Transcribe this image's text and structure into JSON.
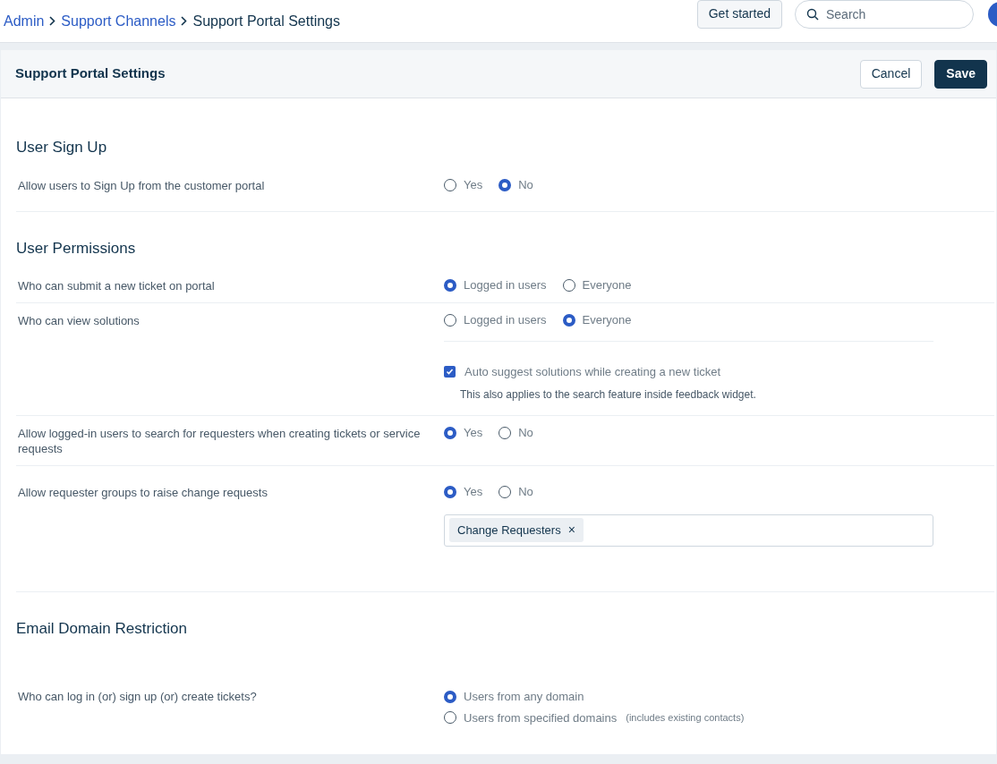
{
  "breadcrumb": [
    {
      "label": "Admin",
      "link": true
    },
    {
      "label": "Support Channels",
      "link": true
    },
    {
      "label": "Support Portal Settings",
      "link": false
    }
  ],
  "top_actions": {
    "get_started": "Get started",
    "search": {
      "placeholder": "Search"
    }
  },
  "header": {
    "title": "Support Portal Settings",
    "buttons": [
      {
        "label": "Cancel",
        "kind": "secondary"
      },
      {
        "label": "Save",
        "kind": "primary"
      }
    ]
  },
  "sections": [
    {
      "title": "User Sign Up",
      "rows": [
        {
          "label": "Allow users to Sign Up from the customer portal",
          "kind": "inline",
          "options": [
            {
              "label": "Yes",
              "selected": false
            },
            {
              "label": "No",
              "selected": true
            }
          ]
        }
      ]
    },
    {
      "title": "User Permissions",
      "rows": [
        {
          "label": "Who can submit a new ticket on portal",
          "kind": "inline",
          "options": [
            {
              "label": "Logged in users",
              "selected": true
            },
            {
              "label": "Everyone",
              "selected": false
            }
          ]
        },
        {
          "label": "Who can view solutions",
          "kind": "inline",
          "options": [
            {
              "label": "Logged in users",
              "selected": false
            },
            {
              "label": "Everyone",
              "selected": true
            }
          ],
          "checkbox": {
            "label": "Auto suggest solutions while creating a new ticket",
            "checked": true,
            "hint": "This also applies to the search feature inside feedback widget."
          }
        },
        {
          "label": "Allow logged-in users to search for requesters when creating tickets or service requests",
          "kind": "inline",
          "options": [
            {
              "label": "Yes",
              "selected": true
            },
            {
              "label": "No",
              "selected": false
            }
          ]
        },
        {
          "label": "Allow requester groups to raise change requests",
          "kind": "inline",
          "options": [
            {
              "label": "Yes",
              "selected": true
            },
            {
              "label": "No",
              "selected": false
            }
          ],
          "tags": [
            {
              "label": "Change Requesters",
              "remove": "×"
            }
          ]
        }
      ]
    },
    {
      "title": "Email Domain Restriction",
      "rows": [
        {
          "label": "Who can log in (or) sign up (or) create tickets?",
          "kind": "stacked",
          "options": [
            {
              "label": "Users from any domain",
              "selected": true
            },
            {
              "label": "Users from specified domains",
              "note": "(includes existing contacts)",
              "selected": false
            }
          ]
        }
      ]
    }
  ]
}
